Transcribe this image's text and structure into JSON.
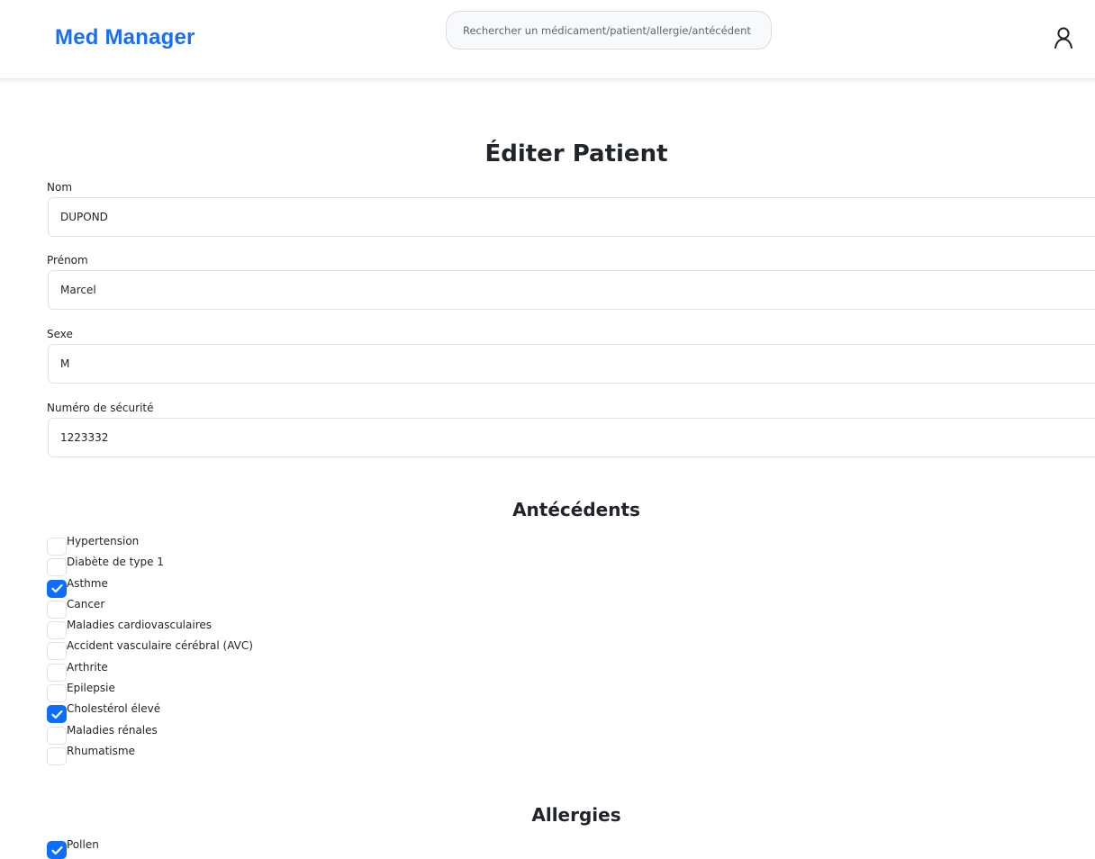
{
  "header": {
    "brand": "Med Manager",
    "search_placeholder": "Rechercher un médicament/patient/allergie/antécédent",
    "brand_color": "#1a6ef5"
  },
  "form": {
    "title": "Éditer Patient",
    "fields": [
      {
        "label": "Nom",
        "value": "DUPOND"
      },
      {
        "label": "Prénom",
        "value": "Marcel"
      },
      {
        "label": "Sexe",
        "value": "M"
      },
      {
        "label": "Numéro de sécurité",
        "value": "1223332"
      }
    ]
  },
  "antecedents": {
    "title": "Antécédents",
    "items": [
      {
        "label": "Hypertension",
        "checked": false
      },
      {
        "label": "Diabète de type 1",
        "checked": false
      },
      {
        "label": "Asthme",
        "checked": true
      },
      {
        "label": "Cancer",
        "checked": false
      },
      {
        "label": "Maladies cardiovasculaires",
        "checked": false
      },
      {
        "label": "Accident vasculaire cérébral (AVC)",
        "checked": false
      },
      {
        "label": "Arthrite",
        "checked": false
      },
      {
        "label": "Epilepsie",
        "checked": false
      },
      {
        "label": "Cholestérol élevé",
        "checked": true
      },
      {
        "label": "Maladies rénales",
        "checked": false
      },
      {
        "label": "Rhumatisme",
        "checked": false
      }
    ]
  },
  "allergies": {
    "title": "Allergies",
    "items": [
      {
        "label": "Pollen",
        "checked": true
      }
    ]
  },
  "icons": {
    "user": "user-icon",
    "check": "check-icon"
  },
  "colors": {
    "checkbox_checked": "#0d6efd"
  }
}
